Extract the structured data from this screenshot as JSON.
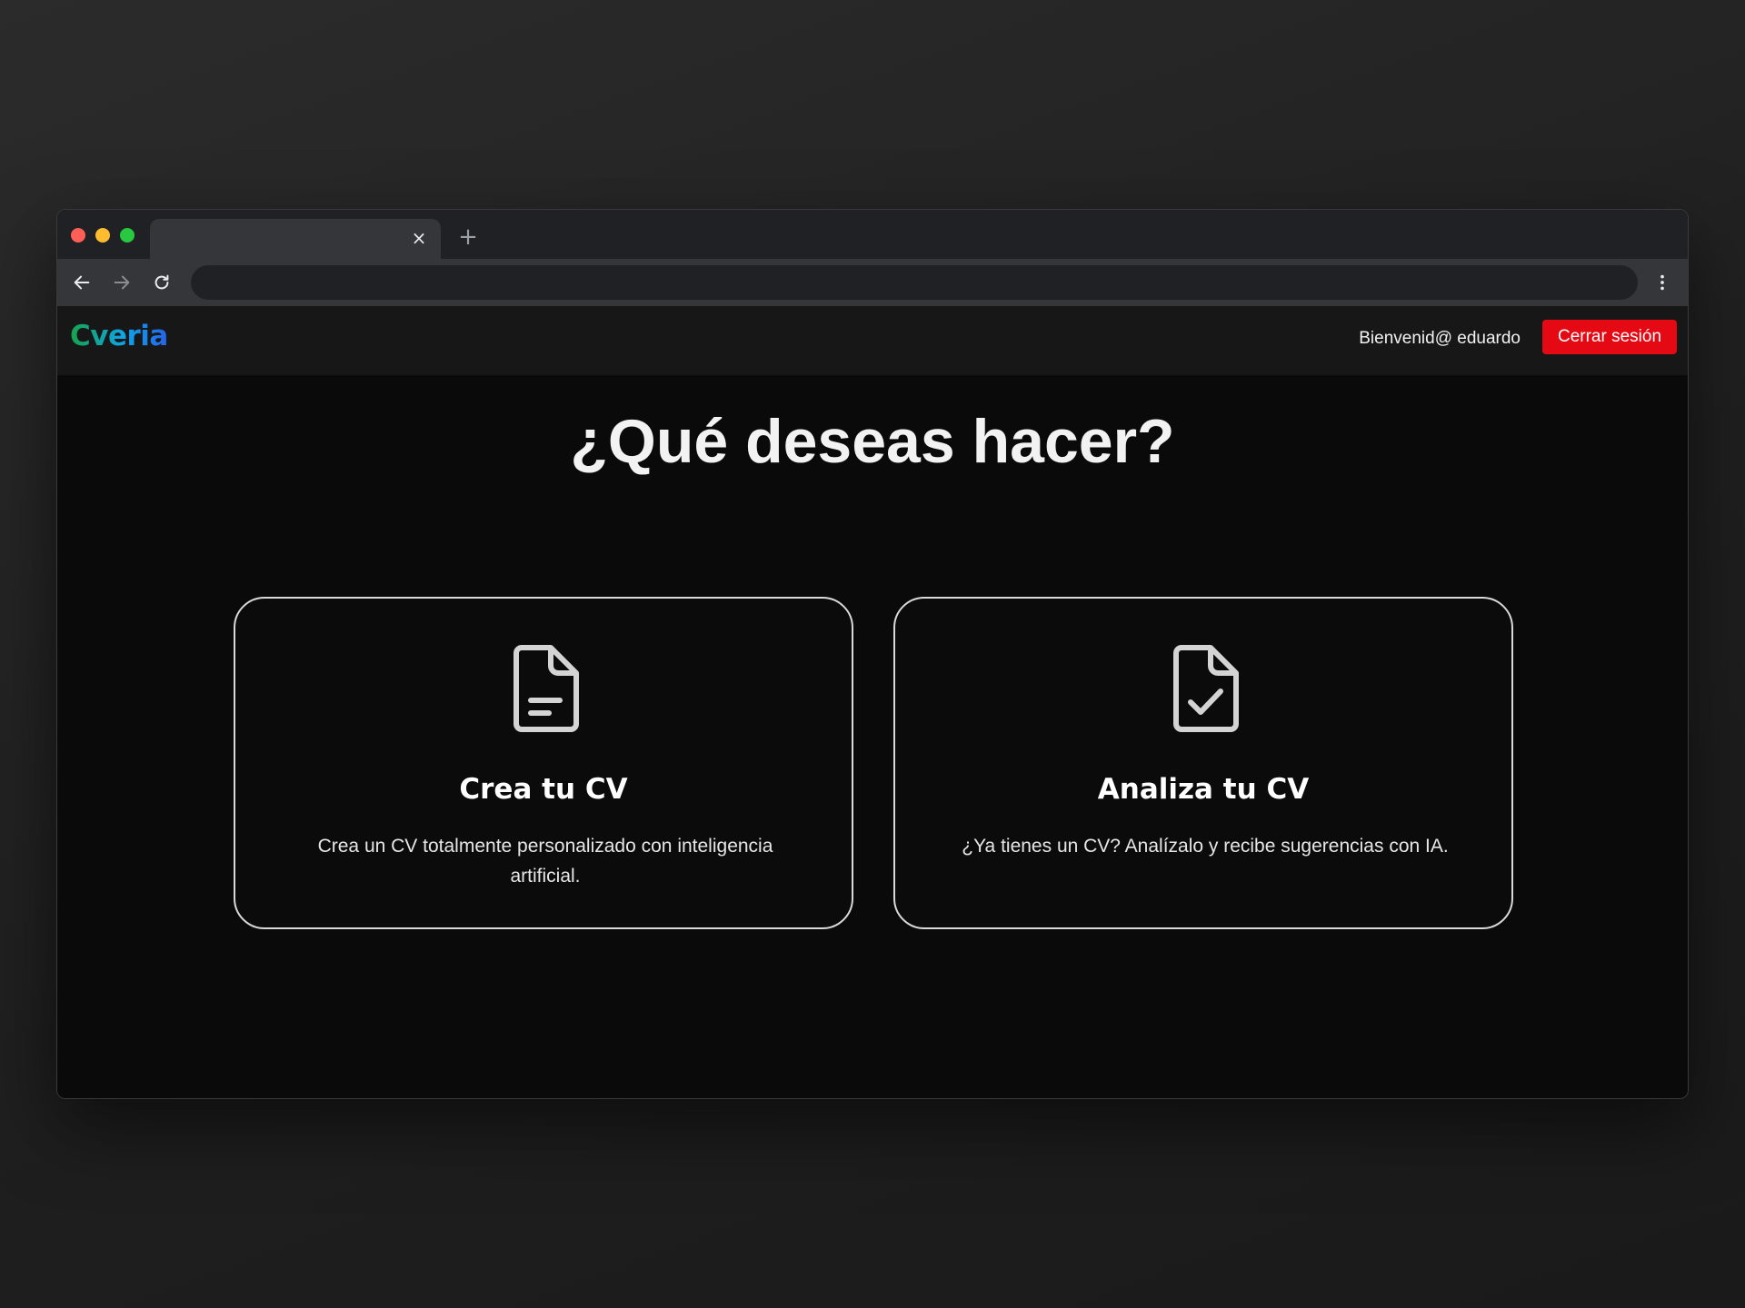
{
  "app": {
    "name": "Cveria",
    "welcome_text": "Bienvenid@ eduardo",
    "logout_label": "Cerrar sesión"
  },
  "browser": {
    "tab_close_glyph": "×",
    "new_tab_glyph": "+"
  },
  "main": {
    "heading": "¿Qué deseas hacer?",
    "cards": [
      {
        "title": "Crea tu CV",
        "description": "Crea un CV totalmente personalizado con inteligencia artificial.",
        "icon": "document-text-icon"
      },
      {
        "title": "Analiza tu CV",
        "description": "¿Ya tienes un CV? Analízalo y recibe sugerencias con IA.",
        "icon": "document-check-icon"
      }
    ]
  },
  "colors": {
    "logout_button": "#e50914",
    "logo_gradient": [
      "#16a34a",
      "#0ea5e9",
      "#2563eb"
    ],
    "page_background": "#0a0a0a"
  }
}
